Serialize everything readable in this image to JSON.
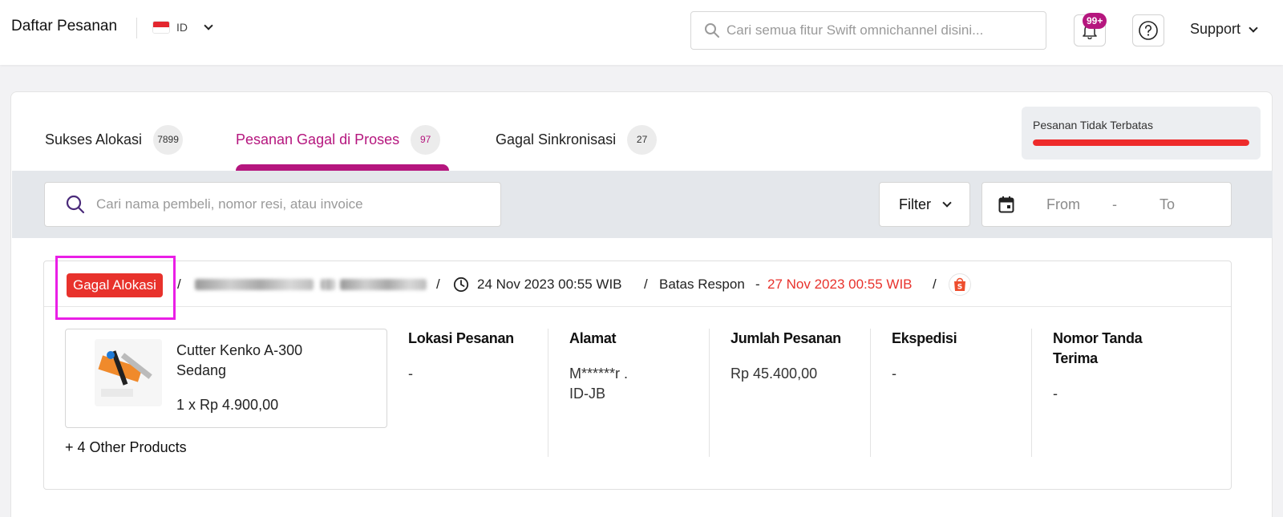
{
  "header": {
    "title": "Daftar Pesanan",
    "lang_code": "ID",
    "search_placeholder": "Cari semua fitur Swift omnichannel disini...",
    "notification_badge": "99+",
    "support_label": "Support"
  },
  "tabs": [
    {
      "label": "Sukses Alokasi",
      "count": "7899"
    },
    {
      "label": "Pesanan Gagal di Proses",
      "count": "97"
    },
    {
      "label": "Gagal Sinkronisasi",
      "count": "27"
    }
  ],
  "limit": {
    "label": "Pesanan Tidak Terbatas",
    "fill_fraction": 1.0,
    "color": "#ee2b2b"
  },
  "filters": {
    "search_placeholder": "Cari nama pembeli, nomor resi, atau invoice",
    "filter_label": "Filter",
    "from_label": "From",
    "dash": "-",
    "to_label": "To"
  },
  "order": {
    "status": "Gagal Alokasi",
    "sep": "/",
    "date": "24 Nov 2023 00:55 WIB",
    "deadline_label": "Batas Respon",
    "deadline_dash": "-",
    "deadline": "27 Nov 2023 00:55 WIB",
    "product": {
      "name": "Cutter Kenko A-300 Sedang",
      "qty_price": "1 x Rp 4.900,00"
    },
    "other_products": "+ 4 Other Products",
    "columns": [
      {
        "head": "Lokasi Pesanan",
        "value": "-"
      },
      {
        "head": "Alamat",
        "value_line1": "M******r .",
        "value_line2": "ID-JB"
      },
      {
        "head": "Jumlah Pesanan",
        "value": "Rp 45.400,00"
      },
      {
        "head": "Ekspedisi",
        "value": "-"
      },
      {
        "head_line1": "Nomor Tanda",
        "head_line2": "Terima",
        "value": "-"
      }
    ]
  },
  "colors": {
    "accent": "#b5167e",
    "danger": "#e8322c",
    "highlight": "#ea1fe6"
  }
}
